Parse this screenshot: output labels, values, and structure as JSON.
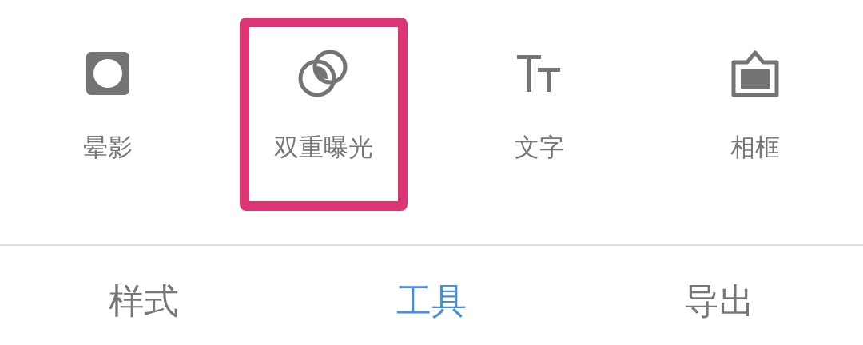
{
  "tools": [
    {
      "kind": "vignette",
      "label": "晕影",
      "highlighted": false
    },
    {
      "kind": "double_exposure",
      "label": "双重曝光",
      "highlighted": true
    },
    {
      "kind": "text",
      "label": "文字",
      "highlighted": false
    },
    {
      "kind": "frame",
      "label": "相框",
      "highlighted": false
    }
  ],
  "tabs": [
    {
      "label": "样式",
      "selected": false
    },
    {
      "label": "工具",
      "selected": true
    },
    {
      "label": "导出",
      "selected": false
    }
  ]
}
